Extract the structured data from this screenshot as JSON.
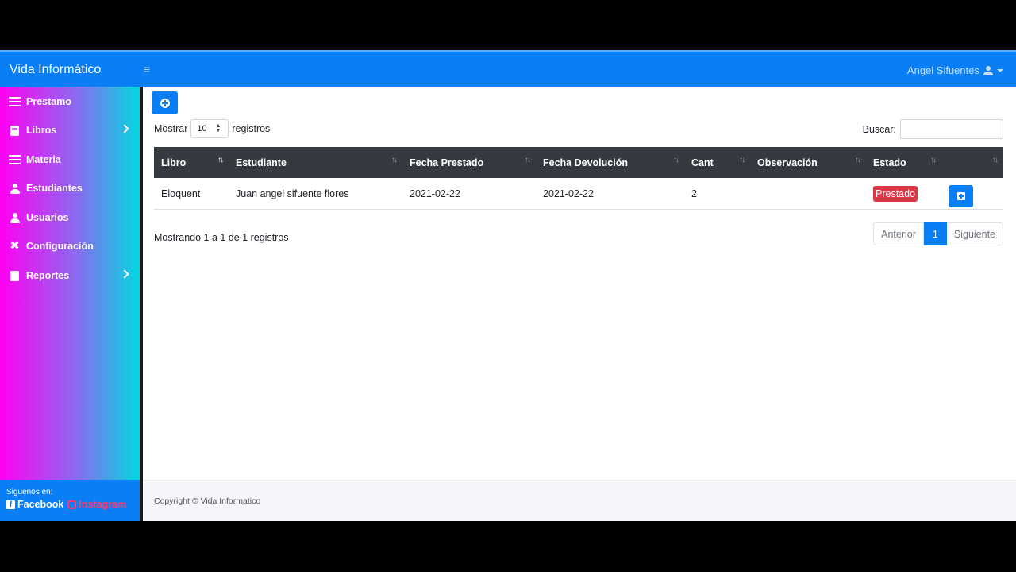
{
  "header": {
    "brand": "Vida Informático",
    "menu_icon": "hamburger-icon",
    "user_name": "Angel Sifuentes"
  },
  "sidebar": {
    "items": [
      {
        "label": "Prestamo",
        "icon": "list-check-icon",
        "has_chevron": false
      },
      {
        "label": "Libros",
        "icon": "book-icon",
        "has_chevron": true
      },
      {
        "label": "Materia",
        "icon": "list-icon",
        "has_chevron": false
      },
      {
        "label": "Estudiantes",
        "icon": "student-icon",
        "has_chevron": false
      },
      {
        "label": "Usuarios",
        "icon": "user-icon",
        "has_chevron": false
      },
      {
        "label": "Configuración",
        "icon": "tools-icon",
        "has_chevron": false
      },
      {
        "label": "Reportes",
        "icon": "pdf-icon",
        "has_chevron": true
      }
    ],
    "footer": {
      "title": "Siguenos en:",
      "facebook": "Facebook",
      "instagram": "Instagram"
    }
  },
  "toolbar": {
    "add_icon": "plus-circle-icon",
    "show_label": "Mostrar",
    "show_value": "10",
    "records_label": "registros",
    "search_label": "Buscar:",
    "search_value": ""
  },
  "table": {
    "columns": [
      "Libro",
      "Estudiante",
      "Fecha Prestado",
      "Fecha Devolución",
      "Cant",
      "Observación",
      "Estado",
      ""
    ],
    "rows": [
      {
        "libro": "Eloquent",
        "estudiante": "Juan angel sifuente flores",
        "fecha_prestado": "2021-02-22",
        "fecha_devolucion": "2021-02-22",
        "cant": "2",
        "observacion": "",
        "estado": "Prestado"
      }
    ]
  },
  "info": "Mostrando 1 a 1 de 1 registros",
  "pagination": {
    "prev": "Anterior",
    "current": "1",
    "next": "Siguiente"
  },
  "footer": {
    "text": "Copyright © Vida Informatico"
  },
  "colors": {
    "primary": "#0a7ff5",
    "danger": "#dc3545",
    "table_header": "#343a40"
  }
}
